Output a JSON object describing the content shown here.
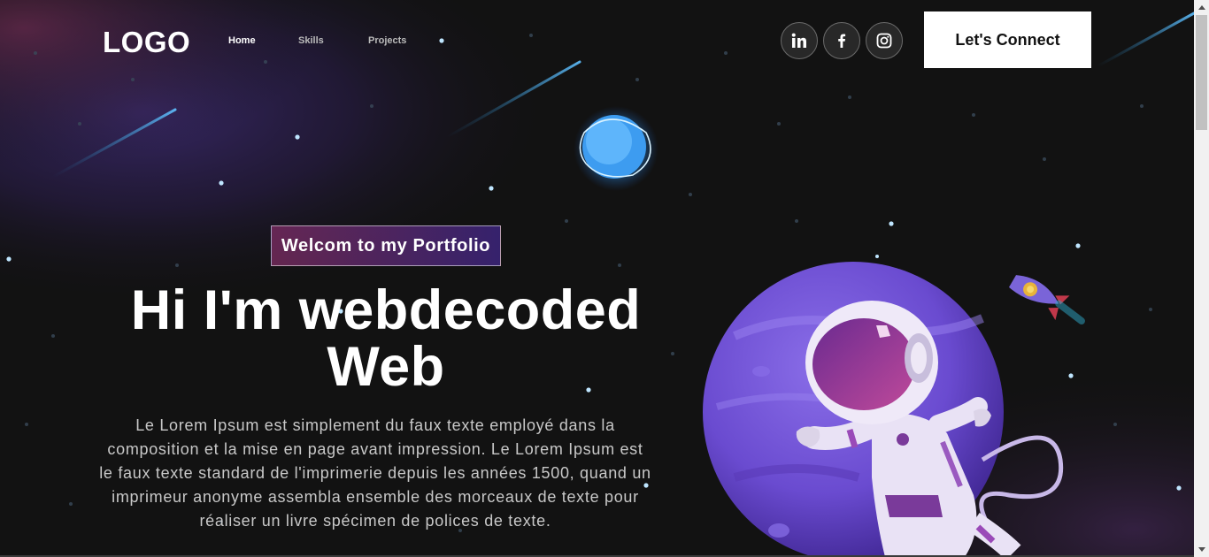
{
  "nav": {
    "logo": "LOGO",
    "links": [
      {
        "label": "Home",
        "active": true
      },
      {
        "label": "Skills",
        "active": false
      },
      {
        "label": "Projects",
        "active": false
      }
    ],
    "socials": [
      {
        "name": "linkedin-icon",
        "label": "in"
      },
      {
        "name": "facebook-icon",
        "label": "f"
      },
      {
        "name": "instagram-icon",
        "label": "instagram"
      }
    ],
    "connect_label": "Let's Connect"
  },
  "banner": {
    "tagline": "Welcom to my Portfolio",
    "headline_line1": "Hi I'm webdecoded",
    "headline_line2": "Web",
    "intro": "Le Lorem Ipsum est simplement du faux texte employé dans la composition et la mise en page avant impression. Le Lorem Ipsum est le faux texte standard de l'imprimerie depuis les années 1500, quand un imprimeur anonyme assembla ensemble des morceaux de texte pour réaliser un livre spécimen de polices de texte."
  },
  "illustration": {
    "astronaut": "astronaut-on-planet",
    "rocket": "rocket-icon",
    "planet": "blue-planet"
  },
  "colors": {
    "background": "#121212",
    "accent_pink": "#AA367C",
    "accent_purple": "#4A2FBD",
    "white": "#FFFFFF"
  }
}
